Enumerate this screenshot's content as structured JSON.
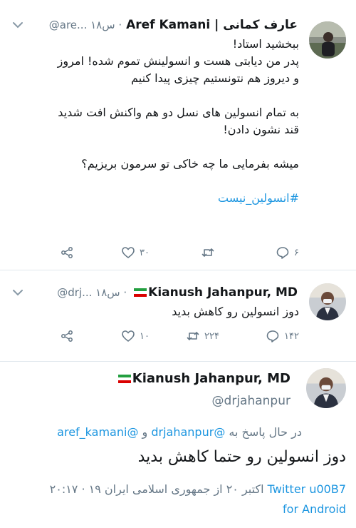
{
  "tweet1": {
    "author_name": "Aref Kamani | عارف کمانی",
    "handle_time": "@are... ۱۸س ·",
    "lines": [
      "ببخشید استاد!",
      "پدر من دیابتی هست و انسولینش تموم شده! امروز",
      "و دیروز هم نتونستیم چیزی پیدا کنیم",
      "به تمام انسولین های نسل دو هم واکنش افت شدید",
      "قند نشون دادن!",
      "میشه بفرمایی ما چه خاکی تو سرمون بریزیم؟"
    ],
    "hashtag": "#انسولین_نیست",
    "reply_count": "۶",
    "retweet_count": "",
    "like_count": "۳۰"
  },
  "tweet2": {
    "author_name": "Kianush Jahanpur, MD",
    "handle_time": "@drj... ۱۸س ·",
    "text": "دوز انسولین رو کاهش بدید",
    "reply_count": "۱۴۲",
    "retweet_count": "۲۲۴",
    "like_count": "۱۰"
  },
  "main_tweet": {
    "author_name": "Kianush Jahanpur, MD",
    "handle": "@drjahanpur",
    "replying_prefix": "در حال پاسخ به",
    "replying_mention1": "@drjahanpur",
    "replying_and": "و",
    "replying_mention2": "@aref_kamani",
    "text": "دوز انسولین رو حتما کاهش بدید",
    "timestamp": "۲۰:۱۷ · ۱۹ اکتبر ۲۰ از جمهوری اسلامی ایران",
    "source_line1": "Twitter u00B7",
    "source_line2": "for Android"
  },
  "icons": {
    "reply": "reply-icon",
    "retweet": "retweet-icon",
    "like": "heart-icon",
    "share": "share-icon",
    "more": "chevron-down-icon"
  },
  "colors": {
    "accent": "#1b95e0",
    "muted": "#657786",
    "text": "#14171a"
  }
}
